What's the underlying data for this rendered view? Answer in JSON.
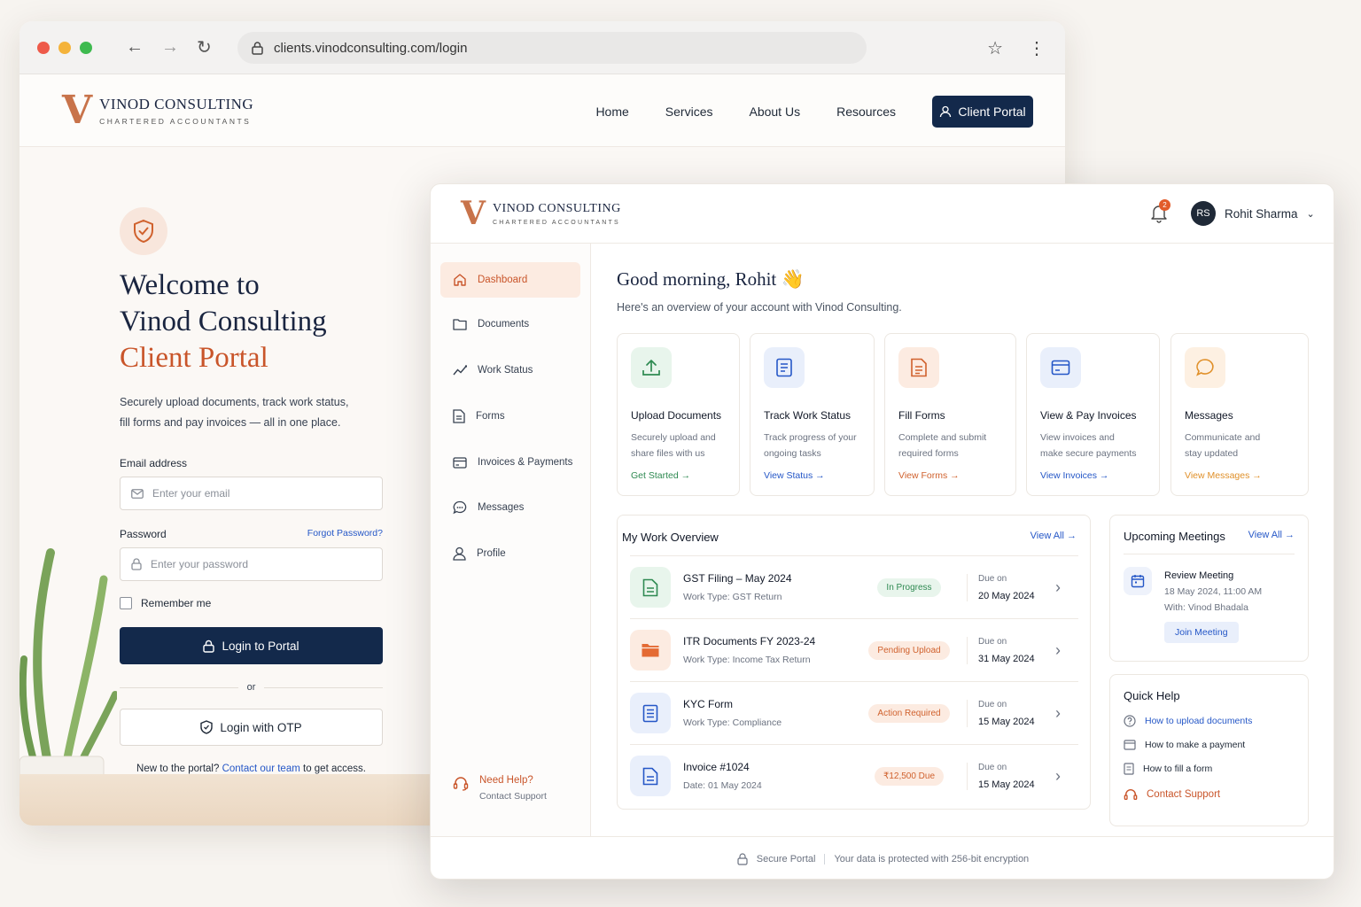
{
  "browser": {
    "url": "clients.vinodconsulting.com/login",
    "traffic_colors": [
      "#ee5a4a",
      "#f4b33b",
      "#3eba4f"
    ]
  },
  "brand": {
    "mark": "V",
    "name": "VINOD CONSULTING",
    "tagline": "CHARTERED ACCOUNTANTS",
    "accent": "#c9552a",
    "navy": "#13294b"
  },
  "site_nav": {
    "items": [
      "Home",
      "Services",
      "About Us",
      "Resources"
    ],
    "portal_button": "Client Portal"
  },
  "login": {
    "heading_line1": "Welcome to",
    "heading_line2": "Vinod Consulting",
    "heading_line3": "Client Portal",
    "intro_line1": "Securely upload documents, track work status,",
    "intro_line2": "fill forms and pay invoices — all in one place.",
    "email_label": "Email address",
    "email_placeholder": "Enter your email",
    "password_label": "Password",
    "forgot": "Forgot Password?",
    "password_placeholder": "Enter your password",
    "remember": "Remember me",
    "login_button": "Login to Portal",
    "or": "or",
    "otp_button": "Login with OTP",
    "new_prefix": "New to the portal?",
    "new_link": "Contact our team",
    "new_suffix": "to get access."
  },
  "dashboard": {
    "notification_count": "2",
    "user_initials": "RS",
    "user_name": "Rohit Sharma",
    "sidebar": [
      {
        "label": "Dashboard",
        "icon": "home-icon"
      },
      {
        "label": "Documents",
        "icon": "folder-icon"
      },
      {
        "label": "Work Status",
        "icon": "trend-icon"
      },
      {
        "label": "Forms",
        "icon": "form-icon"
      },
      {
        "label": "Invoices & Payments",
        "icon": "card-icon"
      },
      {
        "label": "Messages",
        "icon": "chat-icon"
      },
      {
        "label": "Profile",
        "icon": "user-icon"
      }
    ],
    "help": {
      "title": "Need Help?",
      "sub": "Contact Support"
    },
    "greeting": "Good morning, Rohit 👋",
    "greeting_sub": "Here's an overview of your account with Vinod Consulting.",
    "cards": [
      {
        "title": "Upload Documents",
        "desc1": "Securely upload and",
        "desc2": "share files with us",
        "link": "Get Started →",
        "color": "#2f8a52",
        "bg": "#e8f5ec",
        "icon": "upload-icon"
      },
      {
        "title": "Track Work Status",
        "desc1": "Track progress of your",
        "desc2": "ongoing tasks",
        "link": "View Status →",
        "color": "#2557c7",
        "bg": "#e9effb",
        "icon": "document-icon"
      },
      {
        "title": "Fill Forms",
        "desc1": "Complete and submit",
        "desc2": "required forms",
        "link": "View Forms →",
        "color": "#d0612d",
        "bg": "#fcebe1",
        "icon": "form-icon"
      },
      {
        "title": "View & Pay Invoices",
        "desc1": "View invoices and",
        "desc2": "make secure payments",
        "link": "View Invoices →",
        "color": "#2557c7",
        "bg": "#e9effb",
        "icon": "card-icon"
      },
      {
        "title": "Messages",
        "desc1": "Communicate and",
        "desc2": "stay updated",
        "link": "View Messages →",
        "color": "#e0902a",
        "bg": "#fdf0e2",
        "icon": "chat-icon"
      }
    ],
    "overview": {
      "title": "My Work Overview",
      "view_all": "View All →",
      "rows": [
        {
          "title": "GST Filing – May 2024",
          "sub": "Work Type: GST Return",
          "status": "In Progress",
          "status_color": "#2f8a52",
          "status_bg": "#e8f5ec",
          "due_label": "Due on",
          "due": "20 May 2024",
          "icon_color": "#2f8a52",
          "icon_bg": "#e8f5ec"
        },
        {
          "title": "ITR Documents FY 2023-24",
          "sub": "Work Type: Income Tax Return",
          "status": "Pending Upload",
          "status_color": "#d0612d",
          "status_bg": "#fcebe1",
          "due_label": "Due on",
          "due": "31 May 2024",
          "icon_color": "#e46a33",
          "icon_bg": "#fcebe1"
        },
        {
          "title": "KYC Form",
          "sub": "Work Type: Compliance",
          "status": "Action Required",
          "status_color": "#d0612d",
          "status_bg": "#fcebe1",
          "due_label": "Due on",
          "due": "15 May 2024",
          "icon_color": "#2557c7",
          "icon_bg": "#e9effb"
        },
        {
          "title": "Invoice #1024",
          "sub": "Date: 01 May 2024",
          "status": "₹12,500 Due",
          "status_color": "#d0612d",
          "status_bg": "#fcebe1",
          "due_label": "Due on",
          "due": "15 May 2024",
          "icon_color": "#2557c7",
          "icon_bg": "#e9effb"
        }
      ]
    },
    "meetings": {
      "title": "Upcoming Meetings",
      "view_all": "View All →",
      "meeting_title": "Review Meeting",
      "when": "18 May 2024, 11:00 AM",
      "with": "With: Vinod Bhadala",
      "join": "Join Meeting"
    },
    "quick_help": {
      "title": "Quick Help",
      "items": [
        "How to upload documents",
        "How to make a payment",
        "How to fill a form"
      ],
      "contact": "Contact Support"
    },
    "footer": {
      "secure": "Secure Portal",
      "note": "Your data is protected with 256-bit encryption"
    }
  }
}
